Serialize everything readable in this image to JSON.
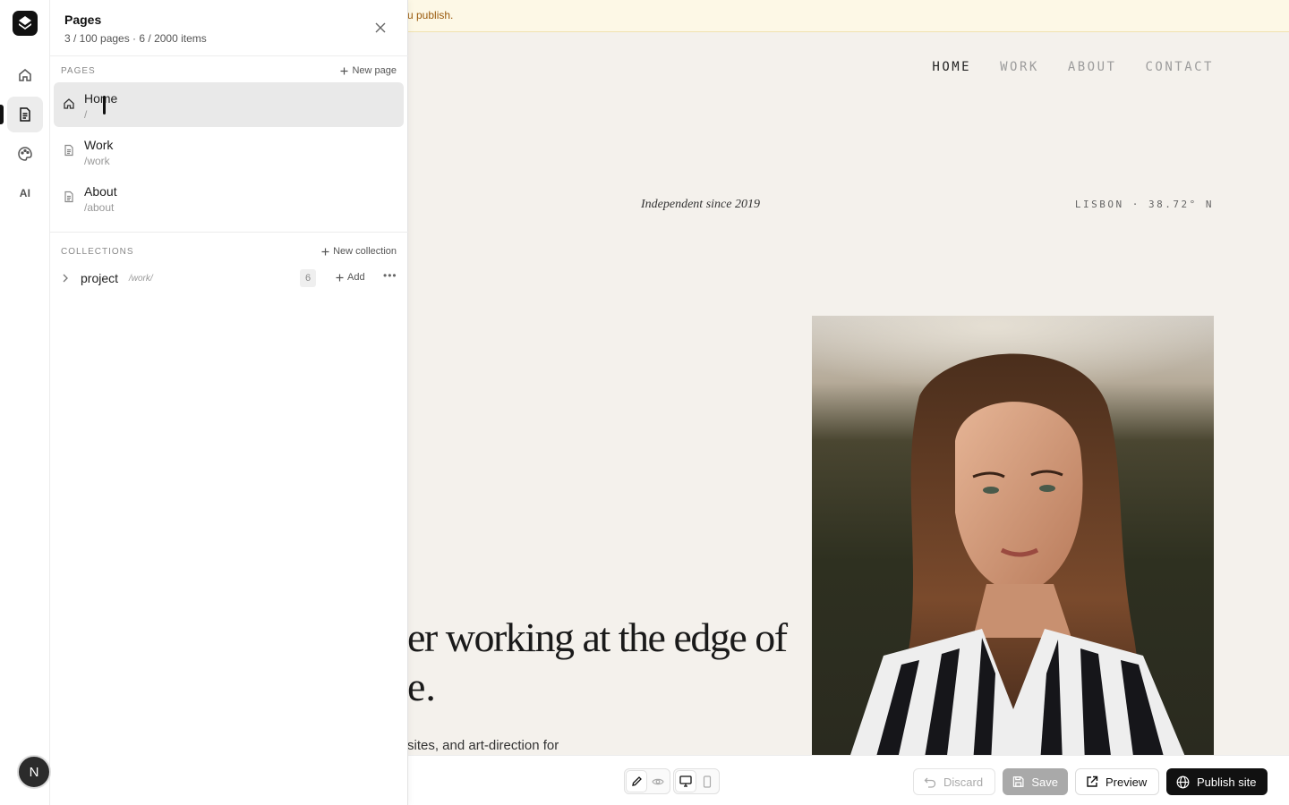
{
  "rail": {
    "items": [
      {
        "name": "home",
        "icon": "home-icon"
      },
      {
        "name": "pages",
        "icon": "pages-icon",
        "active": true
      },
      {
        "name": "design",
        "icon": "palette-icon"
      },
      {
        "name": "ai",
        "label": "AI"
      }
    ],
    "avatar_initial": "N"
  },
  "panel": {
    "title": "Pages",
    "subtitle": "3 / 100 pages · 6 / 2000 items",
    "pages_section_label": "PAGES",
    "new_page_label": "New page",
    "pages": [
      {
        "name": "Home",
        "path": "/",
        "icon": "home-icon",
        "selected": true
      },
      {
        "name": "Work",
        "path": "/work",
        "icon": "document-icon"
      },
      {
        "name": "About",
        "path": "/about",
        "icon": "document-icon"
      }
    ],
    "collections_section_label": "COLLECTIONS",
    "new_collection_label": "New collection",
    "collections": [
      {
        "name": "project",
        "path": "/work/",
        "count": "6",
        "add_label": "Add"
      }
    ]
  },
  "banner": {
    "text": "u publish."
  },
  "site": {
    "nav": [
      "HOME",
      "WORK",
      "ABOUT",
      "CONTACT"
    ],
    "nav_current": "HOME",
    "tagline": "Independent since 2019",
    "coords": "LISBON · 38.72° N",
    "hero_line1": "er working at the edge of",
    "hero_line2": "e.",
    "hero_desc": "sites, and art-direction for"
  },
  "toolbar": {
    "discard_label": "Discard",
    "save_label": "Save",
    "preview_label": "Preview",
    "publish_label": "Publish site"
  },
  "colors": {
    "accent": "#111111",
    "canvas_bg": "#f4f1ec",
    "banner_bg": "#fdf8e6",
    "banner_text": "#9a5a0c"
  }
}
